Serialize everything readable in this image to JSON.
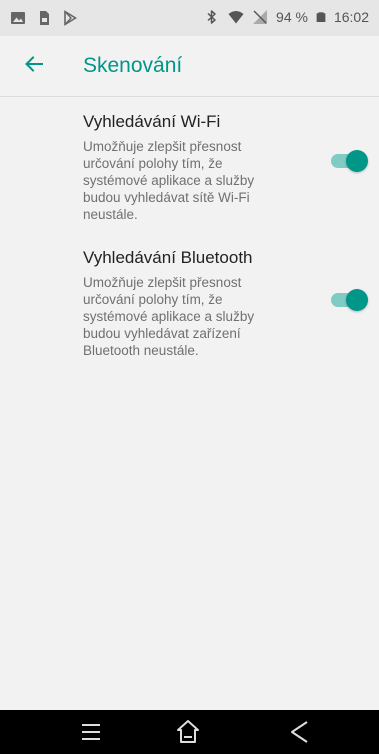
{
  "status_bar": {
    "left_icons": [
      "image-icon",
      "sim-icon",
      "play-store-icon"
    ],
    "right_icons": [
      "bluetooth-icon",
      "wifi-icon",
      "no-signal-icon",
      "battery-icon"
    ],
    "battery_percent": "94 %",
    "time": "16:02"
  },
  "app_bar": {
    "back_icon": "back-arrow-icon",
    "title": "Skenování"
  },
  "settings": [
    {
      "title": "Vyhledávání Wi-Fi",
      "description": "Umožňuje zlepšit přesnost určování polohy tím, že systémové aplikace a služby budou vyhledávat sítě Wi-Fi neustále.",
      "enabled": true
    },
    {
      "title": "Vyhledávání Bluetooth",
      "description": "Umožňuje zlepšit přesnost určování polohy tím, že systémové aplikace a služby budou vyhledávat zařízení Bluetooth neustále.",
      "enabled": true
    }
  ],
  "nav_bar": {
    "icons": [
      "menu-icon",
      "home-icon",
      "back-icon"
    ]
  },
  "colors": {
    "accent": "#009688",
    "accent_light": "#80cbc4",
    "background": "#f2f2f2",
    "status_bar": "#e6e6e6",
    "nav_bar": "#000000"
  }
}
